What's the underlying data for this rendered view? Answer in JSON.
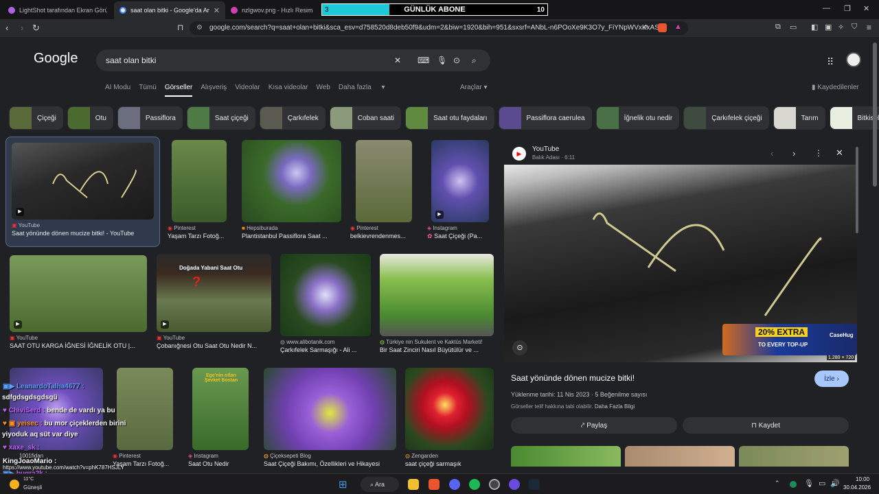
{
  "browser": {
    "tabs": [
      {
        "label": "LightShot tarafından Ekran Görüntüsü",
        "color": "#b060e0"
      },
      {
        "label": "saat olan bitki - Google'da Ara",
        "color": "#e8eaed"
      },
      {
        "label": "nzlgwov.png - Hızlı Resim",
        "color": "#d040b0"
      }
    ],
    "url": "google.com/search?q=saat+olan+bitki&sca_esv=d758520d8deb50f9&udm=2&biw=1920&bih=951&sxsrf=ANbL-n6POoXe9K3O7y_FiYNpWVxKxAS..."
  },
  "overlay": {
    "title": "GÜNLÜK ABONE",
    "start": "3",
    "end": "10",
    "progress": 0.3
  },
  "google": {
    "logo": "Google",
    "query": "saat olan bitki",
    "filters": [
      "AI Modu",
      "Tümü",
      "Görseller",
      "Alışveriş",
      "Videolar",
      "Kısa videolar",
      "Web",
      "Daha fazla"
    ],
    "tools": "Araçlar",
    "saved": "Kaydedilenler"
  },
  "chips": [
    "Çiçeği",
    "Otu",
    "Passiflora",
    "Saat çiçeği",
    "Çarkıfelek",
    "Coban saati",
    "Saat otu faydaları",
    "Passiflora caerulea",
    "İğnelik otu nedir",
    "Çarkıfelek çiçeği",
    "Tarım",
    "Bitkisel"
  ],
  "results": [
    {
      "src": "YouTube",
      "title": "Saat yönünde dönen mucize bitki! - YouTube"
    },
    {
      "src": "Pinterest",
      "title": "Yaşam Tarzı Fotoğ..."
    },
    {
      "src": "Hepsiburada",
      "title": "Plantistanbul Passiflora Saat ..."
    },
    {
      "src": "Pinterest",
      "title": "belkievrendenmes..."
    },
    {
      "src": "Instagram",
      "title": "Saat Çiçeği (Pa..."
    },
    {
      "src": "YouTube",
      "title": "SAAT OTU KARGA İĞNESİ İĞNELİK OTU |..."
    },
    {
      "src": "YouTube",
      "title": "Çobanığnesi Otu Saat Otu Nedir N..."
    },
    {
      "src": "www.alibotanik.com",
      "title": "Çarkıfelek Sarmaşığı - Ali ..."
    },
    {
      "src": "Türkiye nin Sukulent ve Kaktüs Marketi!",
      "title": "Bir Saat Zinciri Nasıl Büyütülür ve ..."
    },
    {
      "src": "Pinterest",
      "title": "Yaşam Tarzı Fotoğ..."
    },
    {
      "src": "Instagram",
      "title": "Saat Otu Nedir"
    },
    {
      "src": "Çiçeksepeti Blog",
      "title": "Saat Çiçeği Bakımı, Özellikleri ve Hikayesi"
    },
    {
      "src": "Zengarden",
      "title": "saat çiçeği sarmaşık"
    }
  ],
  "thumb_text": {
    "video_title": "Doğada Yabani Saat Otu",
    "caption": "Ege'nin otları Şevket Bostan"
  },
  "panel": {
    "source": "YouTube",
    "channel": "Balık Adası · 6:11",
    "resolution": "1.280 × 720",
    "ad_text": "20% EXTRA",
    "ad_sub": "TO EVERY TOP-UP",
    "ad_brand": "CaseHug",
    "title": "Saat yönünde dönen mucize bitki!",
    "watch": "İzle",
    "meta": "Yüklenme tarihi: 11 Nis 2023 · 5 Beğenilme sayısı",
    "copyright": "Görseller telif hakkına tabi olabilir.",
    "more": "Daha Fazla Bilgi",
    "share": "Paylaş",
    "save": "Kaydet"
  },
  "chat": [
    {
      "user": "LeanardoTalha4677 :",
      "color": "#5aa0ff",
      "msg": ""
    },
    {
      "user": "",
      "color": "#fff",
      "msg": "sdfgdsgdsgdsgü"
    },
    {
      "user": "ChiviSerd :",
      "color": "#c060ff",
      "msg": " bende de vardı ya bu"
    },
    {
      "user": "yeisec :",
      "color": "#ff9020",
      "msg": " bu mor çiçeklerden birini"
    },
    {
      "user": "",
      "color": "#fff",
      "msg": "yiyoduk aq süt var diye"
    },
    {
      "user": "xaxe_sk :",
      "color": "#c060ff",
      "msg": ""
    },
    {
      "user": "KingJoaoMario :",
      "color": "#fff",
      "msg": ""
    },
    {
      "user": "",
      "color": "#fff",
      "msg": "https://www.youtube.com/watch?v=phK787HSJLY"
    },
    {
      "user": "bugra2k :",
      "color": "#c060ff",
      "msg": ""
    }
  ],
  "chat_misc": "1001fidan",
  "taskbar": {
    "weather_temp": "11°C",
    "weather_label": "Güneşli",
    "search": "Ara",
    "time": "10:00",
    "date": "30.04.2026"
  }
}
